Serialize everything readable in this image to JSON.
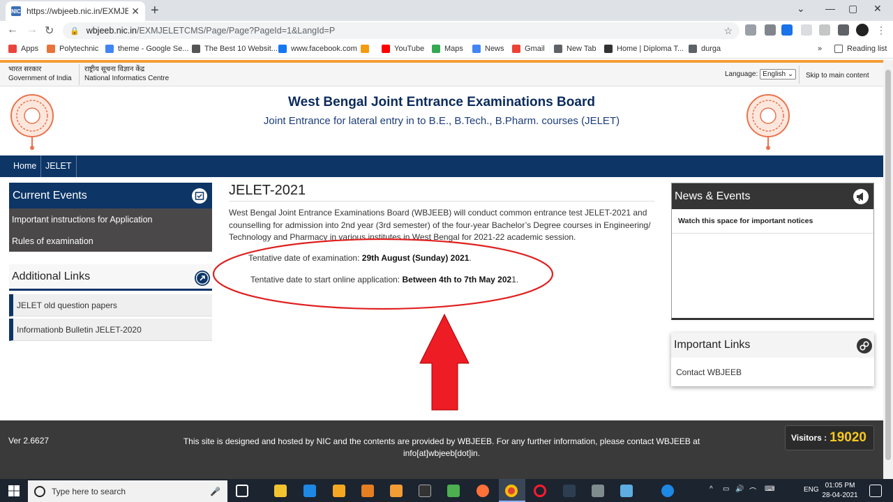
{
  "browser": {
    "tab_title": "https://wbjeeb.nic.in/EXMJELETCM",
    "tab_favicon_text": "NIC",
    "url_host": "wbjeeb.nic.in",
    "url_path": "/EXMJELETCMS/Page/Page?PageId=1&LangId=P"
  },
  "bookmarks": [
    {
      "label": "Apps",
      "icon": "apps-grid-icon",
      "color": "#e8453c"
    },
    {
      "label": "Polytechnic",
      "icon": "polytechnic-icon",
      "color": "#e8743b"
    },
    {
      "label": "theme - Google Se...",
      "icon": "google-icon",
      "color": "#4285f4"
    },
    {
      "label": "The Best 10 Websit...",
      "icon": "gear-icon",
      "color": "#555555"
    },
    {
      "label": "www.facebook.com",
      "icon": "facebook-icon",
      "color": "#1877f2"
    },
    {
      "label": "",
      "icon": "bg-icon",
      "color": "#f39c12"
    },
    {
      "label": "YouTube",
      "icon": "youtube-icon",
      "color": "#ff0000"
    },
    {
      "label": "Maps",
      "icon": "maps-icon",
      "color": "#34a853"
    },
    {
      "label": "News",
      "icon": "news-icon",
      "color": "#4285f4"
    },
    {
      "label": "Gmail",
      "icon": "gmail-icon",
      "color": "#ea4335"
    },
    {
      "label": "New Tab",
      "icon": "globe-icon",
      "color": "#5f6368"
    },
    {
      "label": "Home | Diploma T...",
      "icon": "shield-icon",
      "color": "#333333"
    },
    {
      "label": "durga",
      "icon": "globe-icon",
      "color": "#5f6368"
    }
  ],
  "reading_list": "Reading list",
  "gov": {
    "india_hi": "भारत सरकार",
    "india_en": "Government of India",
    "nic_hi": "राष्ट्रीय सूचना विज्ञान केंद्र",
    "nic_en": "National Informatics Centre",
    "language_label": "Language:",
    "language_value": "English",
    "skip": "Skip to main content"
  },
  "header": {
    "title": "West Bengal Joint Entrance Examinations Board",
    "subtitle": "Joint Entrance for lateral entry in to B.E., B.Tech., B.Pharm. courses (JELET)"
  },
  "nav": [
    "Home",
    "JELET"
  ],
  "current_events": {
    "title": "Current Events",
    "items": [
      "Important instructions for Application",
      "Rules of examination"
    ]
  },
  "additional_links": {
    "title": "Additional Links",
    "items": [
      "JELET old question papers",
      "Informationb Bulletin JELET-2020"
    ]
  },
  "main": {
    "title": "JELET-2021",
    "paragraph": "West Bengal Joint Entrance Examinations Board (WBJEEB) will conduct common entrance test JELET-2021 and counselling for admission into 2nd year (3rd semester) of the four-year Bachelor’s Degree courses in Engineering/ Technology and Pharmacy in various institutes in West Bengal for 2021-22 academic session.",
    "exam_label": "Tentative date of examination: ",
    "exam_value": "29th August (Sunday) 2021",
    "exam_end": ".",
    "app_label": "Tentative date to start online application: ",
    "app_value": "Between 4th to 7th May 202",
    "app_end": "1."
  },
  "news": {
    "title": "News & Events",
    "note": "Watch this space for important notices"
  },
  "important_links": {
    "title": "Important Links",
    "items": [
      "Contact WBJEEB"
    ]
  },
  "footer": {
    "version": "Ver 2.6627",
    "text": "This site is designed and hosted by NIC and the contents are provided by WBJEEB. For any further information, please contact WBJEEB at info[at]wbjeeb[dot]in.",
    "visitors_label": "Visitors :",
    "visitors_count": "19020"
  },
  "taskbar": {
    "search_placeholder": "Type here to search",
    "time": "01:05 PM",
    "date": "28-04-2021",
    "lang": "ENG"
  },
  "colors": {
    "annotation_red": "#e02020",
    "brand_navy": "#0d3566",
    "accent_orange": "#f39c35"
  }
}
